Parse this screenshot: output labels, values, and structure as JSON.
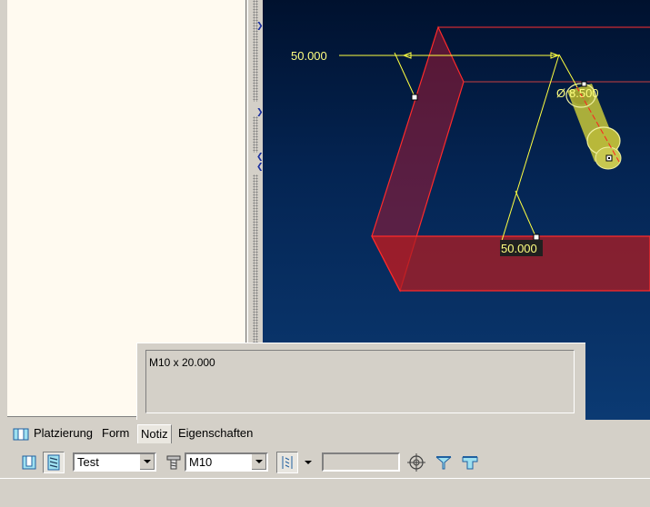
{
  "note": {
    "text": "M10 x 20.000"
  },
  "tabs": [
    {
      "label": "Platzierung",
      "icon": "placement-icon"
    },
    {
      "label": "Form"
    },
    {
      "label": "Notiz",
      "active": true
    },
    {
      "label": "Eigenschaften"
    }
  ],
  "toolbar": {
    "type_combo_value": "Test",
    "size_combo_value": "M10",
    "depth_value": "",
    "icons": [
      "simple-hole-icon",
      "standard-hole-icon",
      "screw-icon",
      "depth-option-icon",
      "crosshair-icon",
      "countersink-icon",
      "counterbore-icon"
    ]
  },
  "viewport": {
    "dim_x": "50.000",
    "dim_y": "50.000",
    "dim_diameter": "8.500",
    "diameter_symbol": "Ø",
    "colors": {
      "background": "#0b3a73",
      "part_edge": "#ff2020",
      "part_fill": "#b0202a",
      "dimension": "#ffff40",
      "hole": "#d8d840"
    }
  }
}
